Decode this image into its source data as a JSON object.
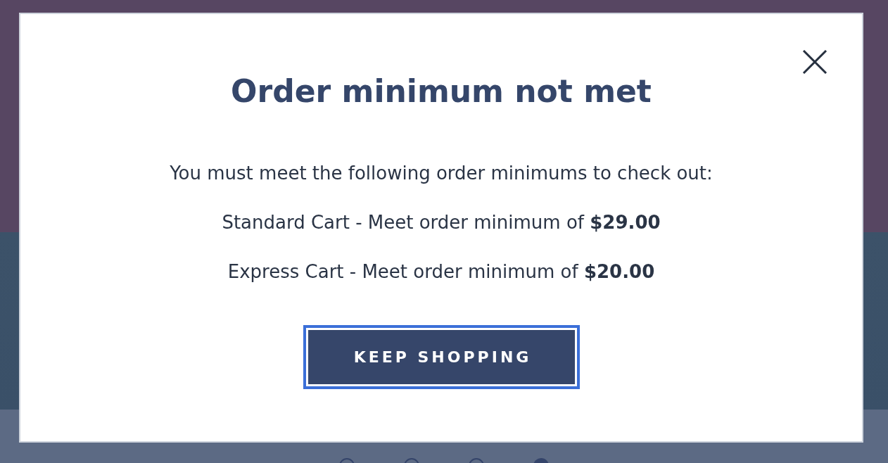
{
  "modal": {
    "title": "Order minimum not met",
    "message": "You must meet the following order minimums to check out:",
    "minimums": [
      {
        "text": "Standard Cart - Meet order minimum of **$29.00**"
      },
      {
        "text": "Express Cart - Meet order minimum of **$20.00**"
      }
    ],
    "button": {
      "label": "KEEP SHOPPING",
      "focused": true
    }
  },
  "carousel": {
    "dots": [
      {
        "selected": false
      },
      {
        "selected": false
      },
      {
        "selected": false
      },
      {
        "selected": true
      }
    ]
  }
}
